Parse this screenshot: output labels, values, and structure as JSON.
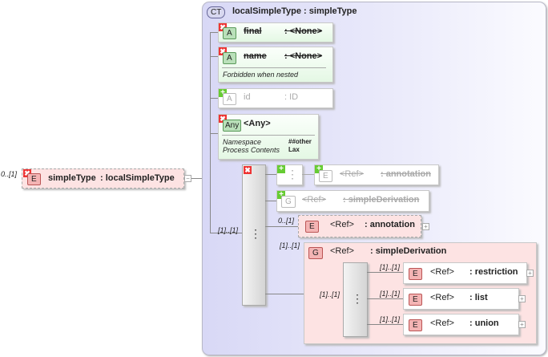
{
  "root": {
    "occurs": "0..[1]",
    "badge": "E",
    "name": "simpleType",
    "type": ": localSimpleType"
  },
  "complex": {
    "badge": "CT",
    "title": "localSimpleType : simpleType"
  },
  "attributes": [
    {
      "badge": "A",
      "name": "final",
      "type": ": <None>"
    },
    {
      "badge": "A",
      "name": "name",
      "type": ": <None>",
      "note": "Forbidden when nested"
    },
    {
      "badge": "A",
      "name": "id",
      "type": ": ID"
    }
  ],
  "any": {
    "badge": "Any",
    "name": "<Any>",
    "ns_label": "Namespace",
    "ns_value": "##other",
    "pc_label": "Process Contents",
    "pc_value": "Lax"
  },
  "sequence": {
    "occurs": "[1]..[1]"
  },
  "children": [
    {
      "badge": "E",
      "name": "<Ref>",
      "type": ": annotation",
      "state": "added"
    },
    {
      "badge": "G",
      "name": "<Ref>",
      "type": ": simpleDerivation",
      "state": "added"
    },
    {
      "badge": "E",
      "name": "<Ref>",
      "type": ": annotation",
      "occurs": "0..[1]"
    },
    {
      "badge": "G",
      "name": "<Ref>",
      "type": ": simpleDerivation",
      "occurs": "[1]..[1]"
    }
  ],
  "group": {
    "occurs": "[1]..[1]",
    "items": [
      {
        "badge": "E",
        "name": "<Ref>",
        "type": ": restriction",
        "occurs": "[1]..[1]"
      },
      {
        "badge": "E",
        "name": "<Ref>",
        "type": ": list",
        "occurs": "[1]..[1]"
      },
      {
        "badge": "E",
        "name": "<Ref>",
        "type": ": union",
        "occurs": "[1]..[1]"
      }
    ]
  },
  "icons": {
    "x": "✖",
    "plus": "+",
    "expand": "+",
    "collapse": "−",
    "seq": "⋮"
  }
}
